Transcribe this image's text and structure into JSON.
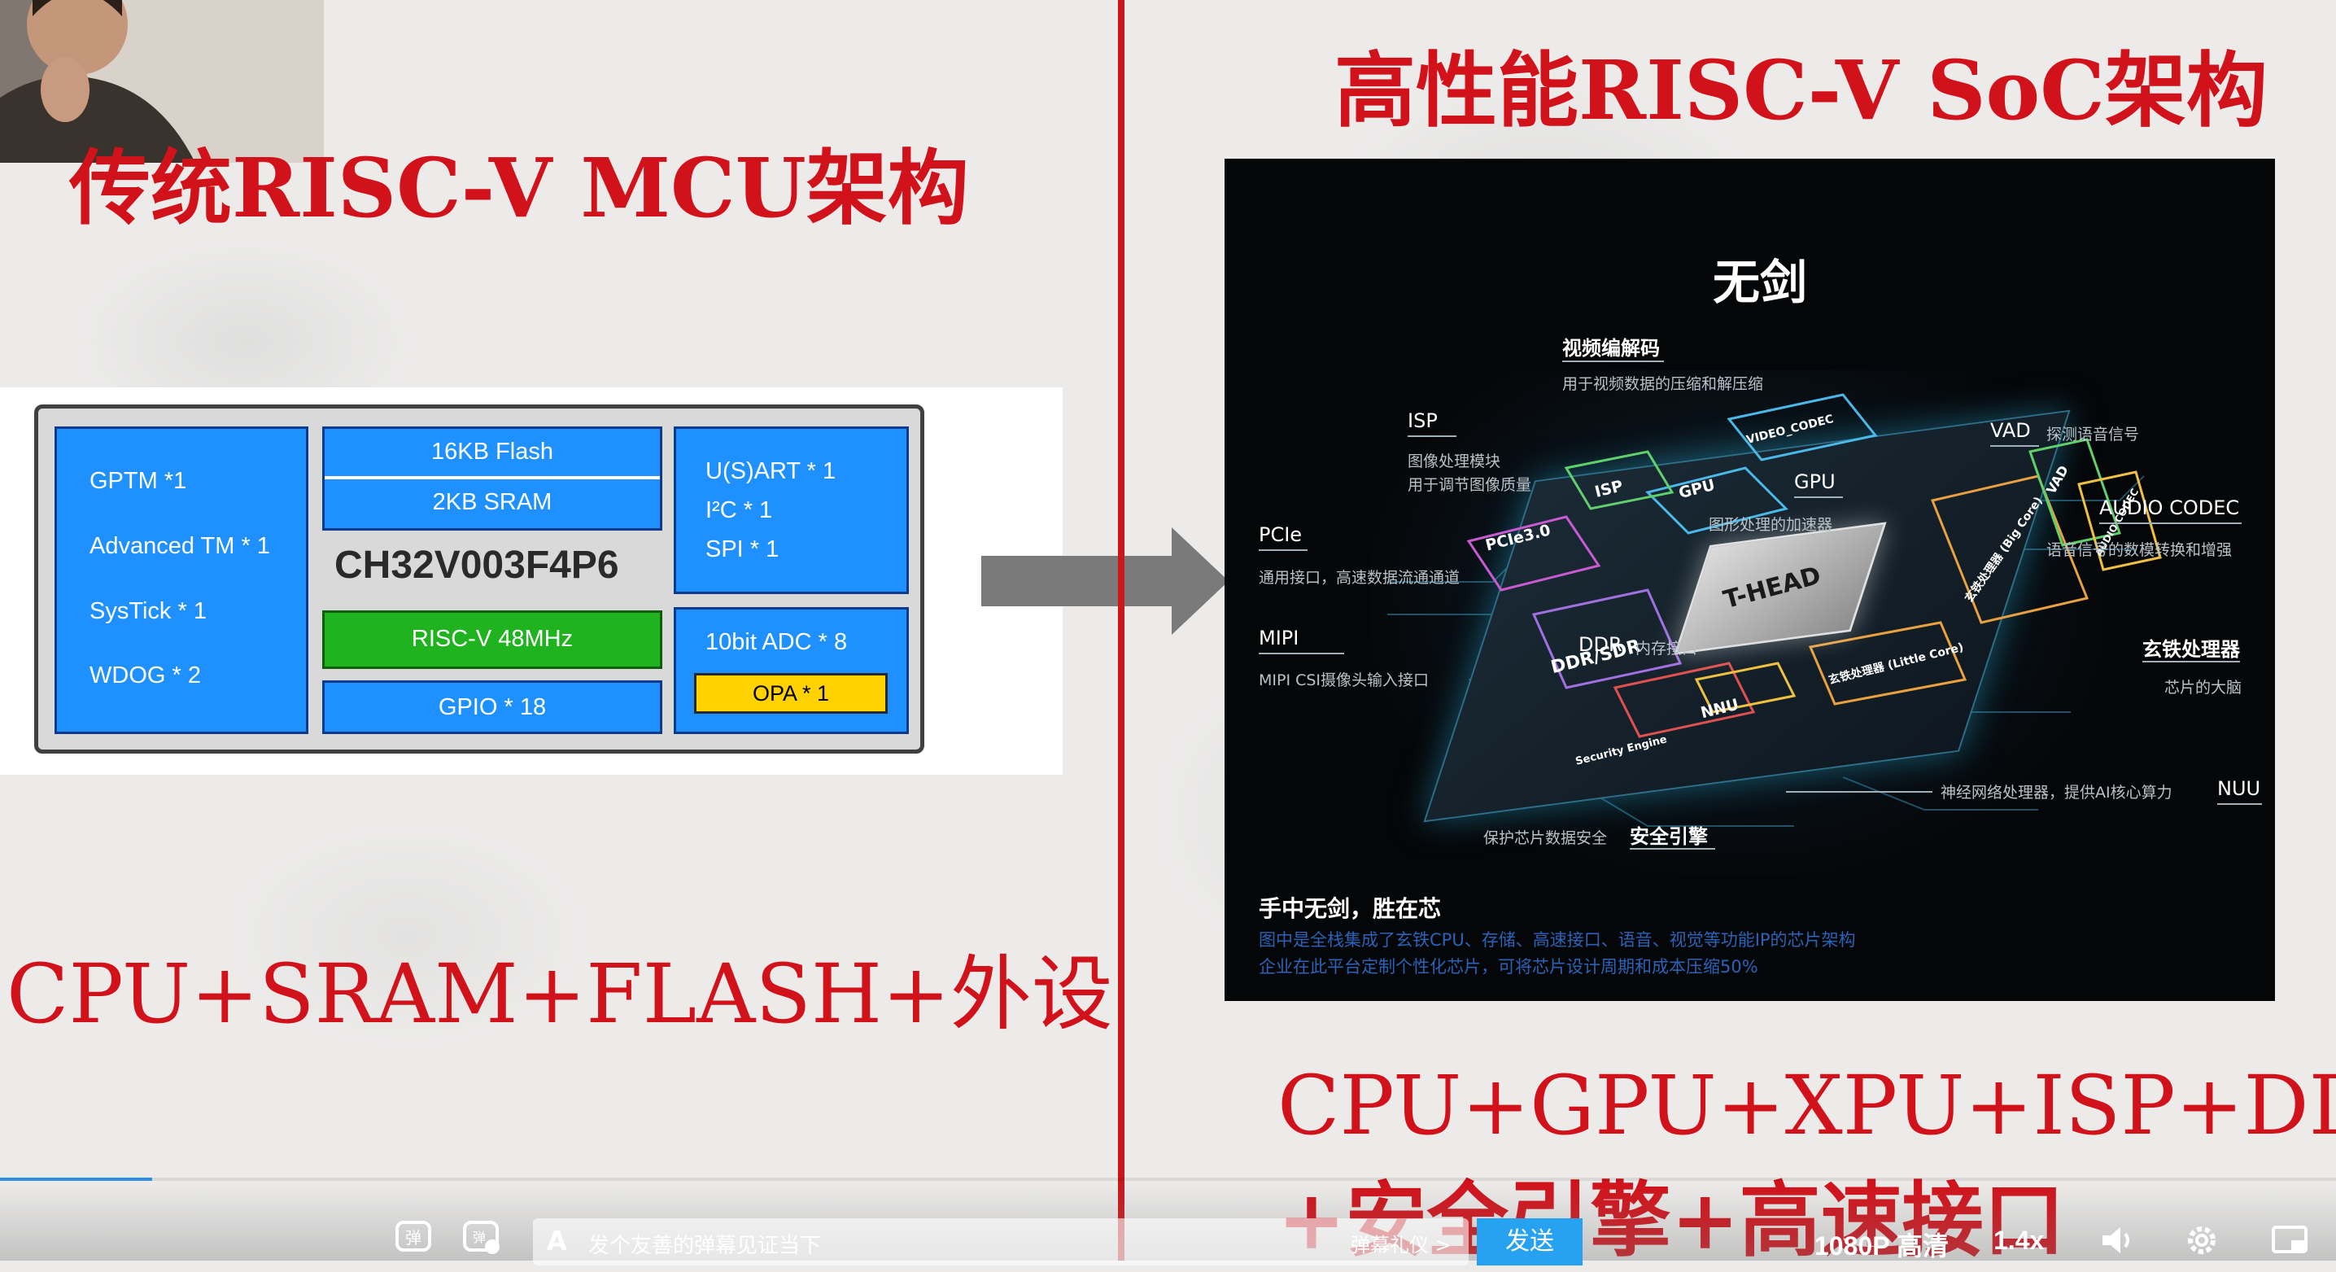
{
  "left": {
    "title": "传统RISC-V MCU架构",
    "formula": "CPU+SRAM+FLASH+外设"
  },
  "right": {
    "title": "高性能RISC-V SoC架构",
    "formula_line1": "CPU+GPU+XPU+ISP+DDR",
    "formula_line2": "+安全引擎+高速接口"
  },
  "mcu": {
    "chip_name": "CH32V003F4P6",
    "left_block": [
      "GPTM *1",
      "Advanced TM * 1",
      "SysTick  * 1",
      "WDOG * 2"
    ],
    "flash": "16KB Flash",
    "sram": "2KB SRAM",
    "cpu": "RISC-V  48MHz",
    "gpio": "GPIO * 18",
    "right_block": [
      "U(S)ART * 1",
      "I²C * 1",
      "SPI * 1"
    ],
    "adc": "10bit ADC * 8",
    "opa": "OPA * 1"
  },
  "soc": {
    "title": "无剑",
    "core_text": "T-HEAD",
    "labels": {
      "video_codec": "视频编解码",
      "video_codec_desc": "用于视频数据的压缩和解压缩",
      "isp": "ISP",
      "isp_desc1": "图像处理模块",
      "isp_desc2": "用于调节图像质量",
      "gpu": "GPU",
      "gpu_desc": "图形处理的加速器",
      "vad": "VAD",
      "vad_desc": "探测语音信号",
      "audio_codec": "AUDIO CODEC",
      "audio_codec_desc": "语音信号的数模转换和增强",
      "pcie": "PCIe",
      "pcie_desc": "通用接口，高速数据流通通道",
      "mipi": "MIPI",
      "mipi_desc": "MIPI CSI摄像头输入接口",
      "ddr": "DDR",
      "ddr_desc": "内存接口",
      "xuantie": "玄铁处理器",
      "xuantie_desc": "芯片的大脑",
      "nuu": "NUU",
      "nuu_desc": "神经网络处理器，提供AI核心算力",
      "security": "安全引擎",
      "security_desc": "保护芯片数据安全"
    },
    "board_tags": [
      "PCIe3.0",
      "DDR/SDR",
      "NNU",
      "GPU",
      "VIDEO_CODEC",
      "Security Engine",
      "玄铁处理器 (Big Core)",
      "玄铁处理器 (Little Core)",
      "AUDIO CODEC",
      "VAD",
      "ISP"
    ],
    "caption_title": "手中无剑，胜在芯",
    "caption_line1": "图中是全栈集成了玄铁CPU、存储、高速接口、语音、视觉等功能IP的芯片架构",
    "caption_line2": "企业在此平台定制个性化芯片，可将芯片设计周期和成本压缩50%"
  },
  "player": {
    "danmaku_placeholder": "发个友善的弹幕见证当下",
    "danmaku_etiquette": "弹幕礼仪 >",
    "send": "发送",
    "quality": "1080P 高清",
    "speed": "1.4x",
    "progress_fraction": 0.065,
    "accent": "#27a2f0"
  }
}
